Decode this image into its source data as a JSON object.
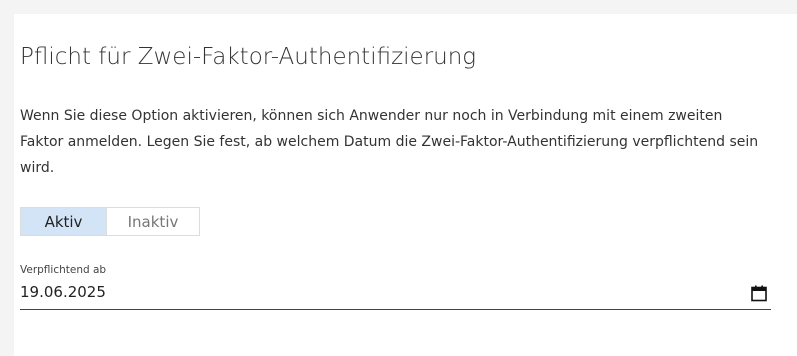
{
  "section": {
    "title": "Pflicht für Zwei-Faktor-Authentifizierung",
    "description": "Wenn Sie diese Option aktivieren, können sich Anwender nur noch in Verbindung mit einem zweiten Faktor anmelden. Legen Sie fest, ab welchem Datum die Zwei-Faktor-Authentifizierung verpflichtend sein wird."
  },
  "toggle": {
    "active_label": "Aktiv",
    "inactive_label": "Inaktiv",
    "selected": "Aktiv"
  },
  "date_field": {
    "label": "Verpflichtend ab",
    "value": "19.06.2025",
    "icon": "calendar-icon"
  },
  "colors": {
    "page_background": "#f4f4f4",
    "card_background": "#ffffff",
    "active_toggle_background": "#d4e4f7",
    "text": "#333333"
  }
}
